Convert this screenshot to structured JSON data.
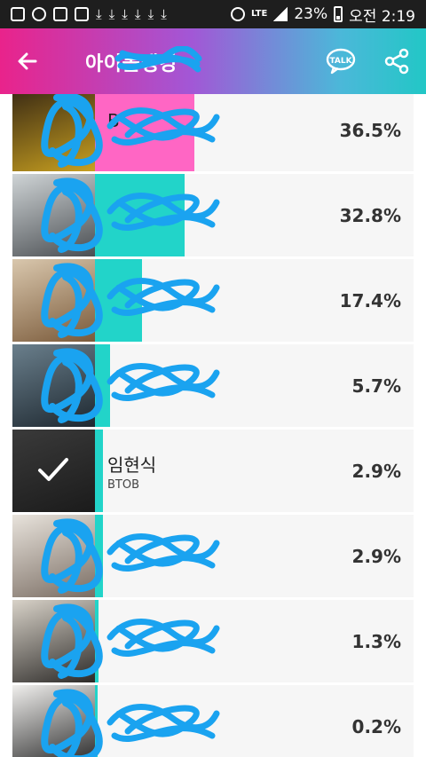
{
  "status_bar": {
    "battery": "23%",
    "time": "오전 2:19",
    "network": "LTE"
  },
  "header": {
    "title": "아이돌랭킹",
    "back_icon": "arrow-left-icon",
    "talk_label": "TALK",
    "share_icon": "share-icon"
  },
  "rows": [
    {
      "name": "B",
      "group": "",
      "percent": "36.5%",
      "bar_fraction": 0.365,
      "bar_color": "#ff66c4",
      "selected": false
    },
    {
      "name": "",
      "group": "",
      "percent": "32.8%",
      "bar_fraction": 0.328,
      "bar_color": "#22d4c9",
      "selected": false
    },
    {
      "name": "",
      "group": "",
      "percent": "17.4%",
      "bar_fraction": 0.174,
      "bar_color": "#22d4c9",
      "selected": false
    },
    {
      "name": "",
      "group": "",
      "percent": "5.7%",
      "bar_fraction": 0.057,
      "bar_color": "#22d4c9",
      "selected": false
    },
    {
      "name": "임현식",
      "group": "BTOB",
      "percent": "2.9%",
      "bar_fraction": 0.029,
      "bar_color": "#22d4c9",
      "selected": true
    },
    {
      "name": "",
      "group": "",
      "percent": "2.9%",
      "bar_fraction": 0.029,
      "bar_color": "#22d4c9",
      "selected": false
    },
    {
      "name": "",
      "group": "",
      "percent": "1.3%",
      "bar_fraction": 0.013,
      "bar_color": "#22d4c9",
      "selected": false
    },
    {
      "name": "",
      "group": "",
      "percent": "0.2%",
      "bar_fraction": 0.002,
      "bar_color": "#22d4c9",
      "selected": false
    }
  ],
  "colors": {
    "scribble": "#1aa3f0",
    "row_bg": "#f6f6f6"
  }
}
